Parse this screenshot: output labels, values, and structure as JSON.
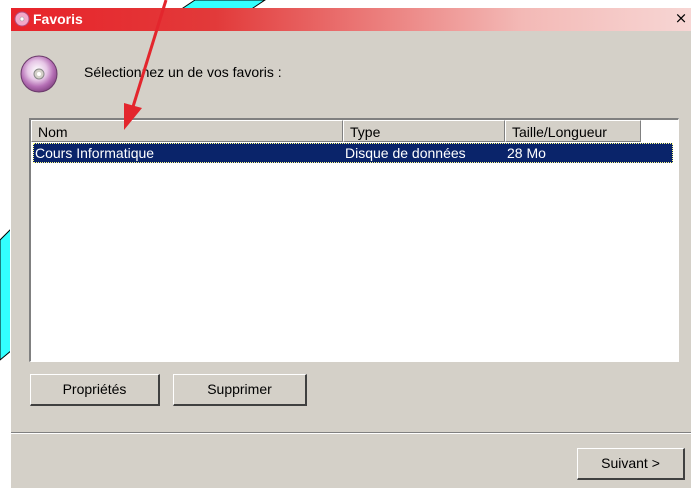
{
  "window": {
    "title": "Favoris",
    "close_glyph": "×",
    "title_icon": "favorites-cd-icon"
  },
  "prompt": "Sélectionnez un de vos favoris :",
  "list": {
    "columns": [
      "Nom",
      "Type",
      "Taille/Longueur"
    ],
    "rows": [
      {
        "name": "Cours Informatique",
        "type": "Disque de données",
        "size": "28 Mo",
        "selected": true
      }
    ]
  },
  "buttons": {
    "properties": "Propriétés",
    "delete": "Supprimer",
    "next": "Suivant >"
  },
  "colors": {
    "titlebar_start": "#e8232a",
    "selection": "#0a246a",
    "annotation_arrow": "#e3262d",
    "annotation_fill": "#33ffff"
  }
}
